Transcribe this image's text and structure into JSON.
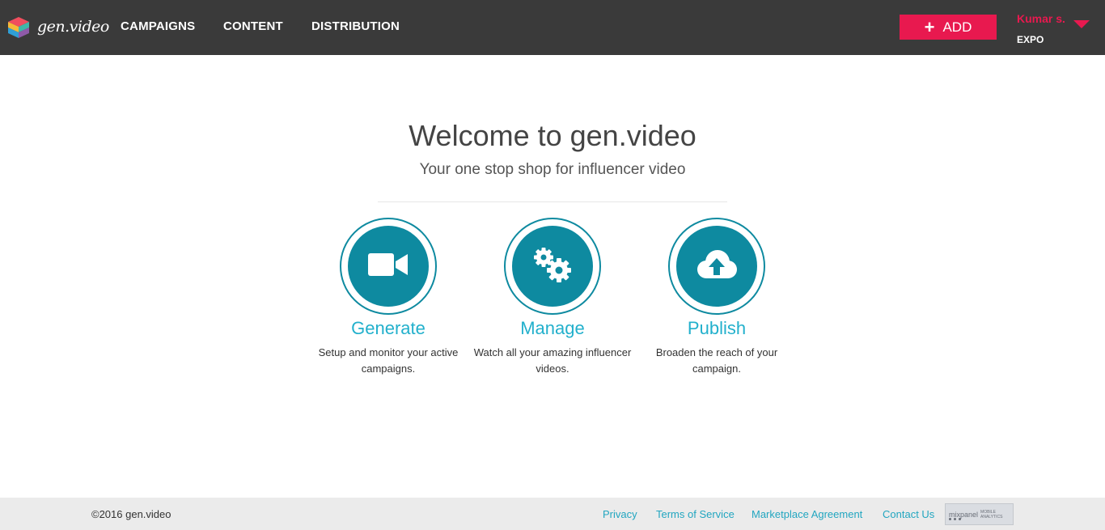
{
  "brand": {
    "logo_text": "gen.video",
    "logo_icon": "gen-video-logo-icon"
  },
  "nav": {
    "items": [
      {
        "label": "CAMPAIGNS"
      },
      {
        "label": "CONTENT"
      },
      {
        "label": "DISTRIBUTION"
      }
    ]
  },
  "header": {
    "add_label": "ADD",
    "add_icon": "plus-icon",
    "user_name": "Kumar s.",
    "user_org": "EXPO",
    "menu_icon": "caret-down-icon"
  },
  "hero": {
    "title": "Welcome to gen.video",
    "subtitle": "Your one stop shop for influencer video"
  },
  "features": [
    {
      "title": "Generate",
      "description": "Setup and monitor your active campaigns.",
      "icon": "video-camera-icon"
    },
    {
      "title": "Manage",
      "description": "Watch all your amazing influencer videos.",
      "icon": "gears-icon"
    },
    {
      "title": "Publish",
      "description": "Broaden the reach of your campaign.",
      "icon": "cloud-upload-icon"
    }
  ],
  "footer": {
    "copyright": "©2016 gen.video",
    "links": [
      {
        "label": "Privacy"
      },
      {
        "label": "Terms of Service"
      },
      {
        "label": "Marketplace Agreement"
      },
      {
        "label": "Contact Us"
      }
    ],
    "badge": {
      "name": "mixpanel",
      "tag_line1": "MOBILE",
      "tag_line2": "ANALYTICS"
    }
  },
  "colors": {
    "topbar": "#3a3a3a",
    "accent": "#e8194f",
    "teal": "#0e8aa0",
    "link": "#22a6c0",
    "footer_bg": "#ebebeb"
  }
}
